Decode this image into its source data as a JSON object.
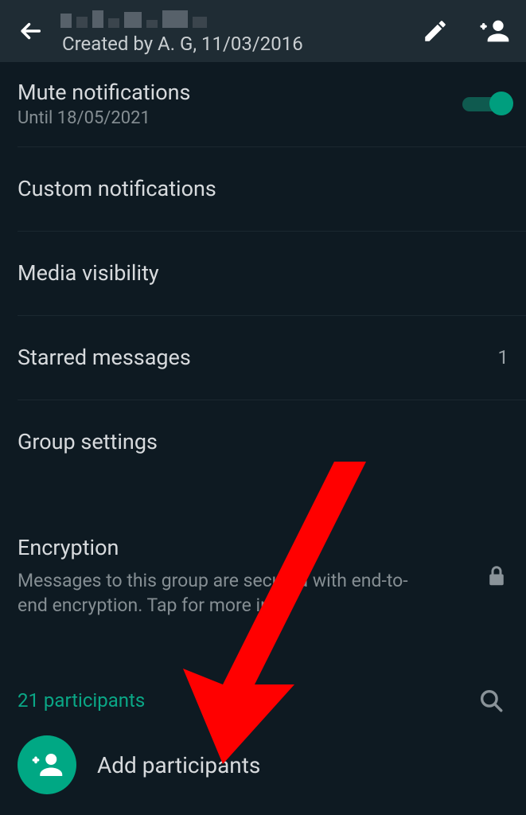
{
  "header": {
    "subtitle": "Created by A. G, 11/03/2016"
  },
  "rows": {
    "mute": {
      "title": "Mute notifications",
      "sub": "Until 18/05/2021"
    },
    "custom": {
      "title": "Custom notifications"
    },
    "media": {
      "title": "Media visibility"
    },
    "starred": {
      "title": "Starred messages",
      "value": "1"
    },
    "group": {
      "title": "Group settings"
    }
  },
  "encryption": {
    "title": "Encryption",
    "sub": "Messages to this group are secured with end-to-end encryption. Tap for more info."
  },
  "participants": {
    "count_label": "21 participants",
    "add_label": "Add participants"
  },
  "colors": {
    "accent": "#00a884"
  }
}
